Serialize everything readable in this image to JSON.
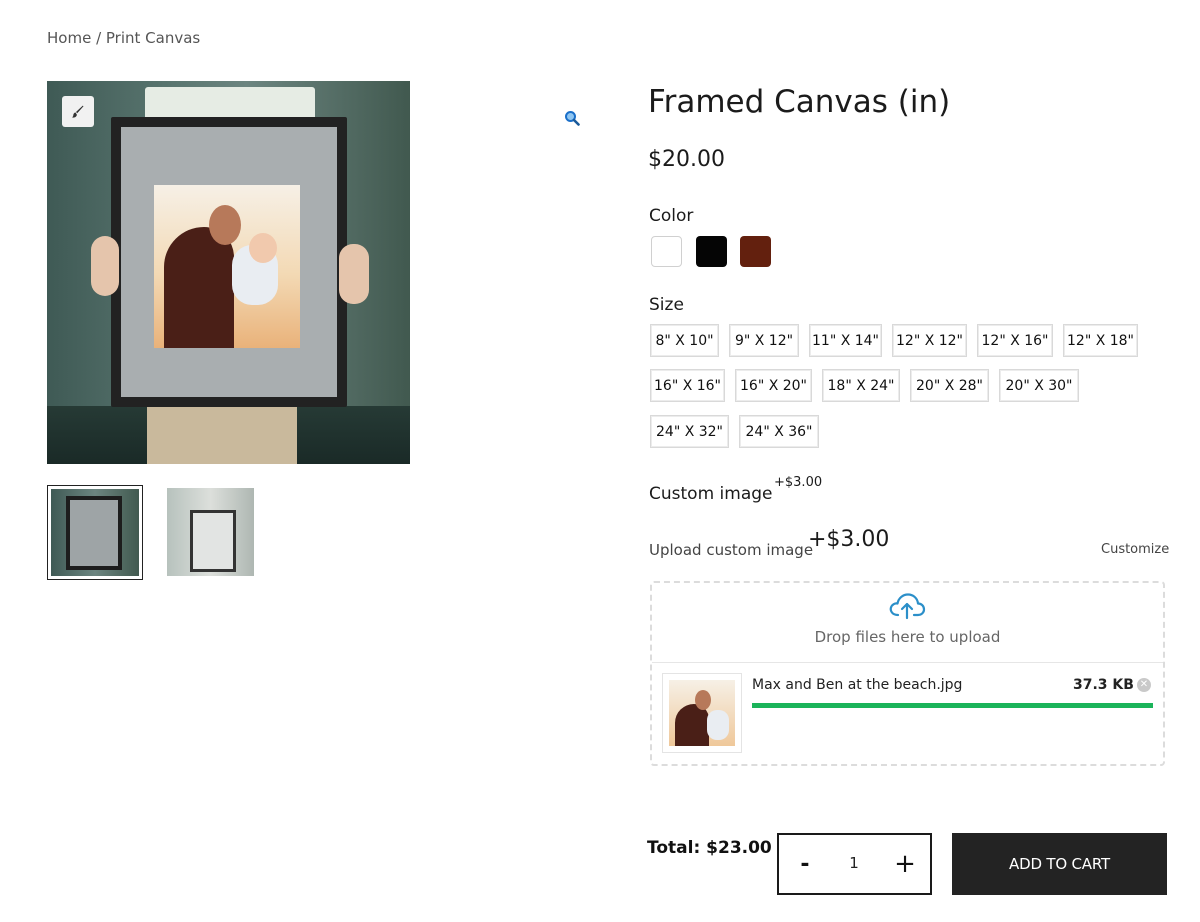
{
  "breadcrumb": {
    "home": "Home",
    "separator": " / ",
    "current": "Print Canvas"
  },
  "gallery": {
    "customize_icon": "paintbrush-icon",
    "zoom_icon": "magnifier-icon",
    "thumbnails": [
      "thumbnail-1",
      "thumbnail-2"
    ]
  },
  "product": {
    "title": "Framed Canvas (in)",
    "price": "$20.00"
  },
  "color": {
    "label": "Color",
    "options": [
      {
        "name": "white",
        "hex": "#ffffff"
      },
      {
        "name": "black",
        "hex": "#050505"
      },
      {
        "name": "brown",
        "hex": "#63200e"
      }
    ]
  },
  "size": {
    "label": "Size",
    "options": [
      "8\" X 10\"",
      "9\" X 12\"",
      "11\" X 14\"",
      "12\" X 12\"",
      "12\" X 16\"",
      "12\" X 18\"",
      "16\" X 16\"",
      "16\" X 20\"",
      "18\" X 24\"",
      "20\" X 28\"",
      "20\" X 30\"",
      "24\" X 32\"",
      "24\" X 36\""
    ]
  },
  "custom_image": {
    "title": "Custom image",
    "title_price": "+$3.00",
    "upload_label": "Upload custom image",
    "upload_price": "+$3.00",
    "customize_link": "Customize",
    "drop_text": "Drop files here to upload",
    "cloud_icon": "cloud-upload-icon",
    "file": {
      "name": "Max and Ben at the beach.jpg",
      "size": "37.3 KB",
      "progress": 1.0,
      "remove_icon": "close-circle-icon"
    }
  },
  "cart": {
    "total": "Total: $23.00",
    "qty_minus": "-",
    "qty_value": "1",
    "qty_plus": "+",
    "add_to_cart": "ADD TO CART"
  },
  "colors": {
    "progress": "#1bb45a",
    "button_bg": "#232323",
    "cloud_icon": "#2b8fc9"
  }
}
